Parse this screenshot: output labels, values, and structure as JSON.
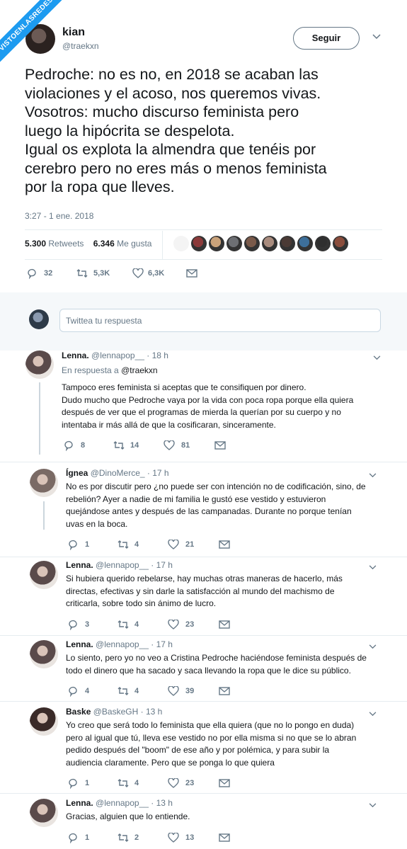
{
  "watermark": "VISTOENLASREDES.COM",
  "main_tweet": {
    "name": "kian",
    "handle": "@traekxn",
    "follow_label": "Seguir",
    "text_lines": [
      "Pedroche: no es no, en 2018 se acaban las",
      "violaciones y el acoso, nos queremos vivas.",
      "Vosotros: mucho discurso feminista pero",
      "luego la hipócrita se despelota.",
      "Igual os explota la almendra que tenéis por",
      "cerebro pero no eres más o menos feminista",
      "por la ropa que lleves."
    ],
    "timestamp": "3:27 - 1 ene. 2018",
    "retweets_count": "5.300",
    "retweets_label": "Retweets",
    "likes_count": "6.346",
    "likes_label": "Me gusta",
    "liker_colors": [
      "#d8d8d8",
      "#8b3a3a",
      "#c9a27a",
      "#6d6f73",
      "#7a5a4a",
      "#a98c7e",
      "#4a3a35",
      "#3d6f9a",
      "#2f2f2f",
      "#8a4d3c"
    ],
    "replies": "32",
    "retweets_short": "5,3K",
    "likes_short": "6,3K"
  },
  "reply_box": {
    "placeholder": "Twittea tu respuesta"
  },
  "replies": [
    {
      "name": "Lenna.",
      "handle": "@lennapop__",
      "time": "· 18 h",
      "in_reply_prefix": "En respuesta a",
      "in_reply_user": "@traekxn",
      "lines": [
        "Tampoco eres feminista si aceptas que te consifiquen por dinero.",
        "Dudo mucho que Pedroche vaya por la vida con poca ropa porque ella quiera",
        "después de ver que el programas de mierda la querían por su cuerpo y no",
        "intentaba ir más allá de que la cosificaran, sinceramente."
      ],
      "reply_count": "8",
      "retweet_count": "14",
      "like_count": "81",
      "avatar_color": "#5a4a4a"
    },
    {
      "name": "Ígnea",
      "handle": "@DinoMerce_",
      "time": "· 17 h",
      "lines": [
        "No es por discutir pero ¿no puede ser con intención no de codificación, sino, de",
        "rebelión? Ayer a nadie de mi familia le gustó ese vestido y estuvieron",
        "quejándose antes y después de las campanadas. Durante no porque tenían",
        "uvas en la boca."
      ],
      "reply_count": "1",
      "retweet_count": "4",
      "like_count": "21",
      "avatar_color": "#7a6a65"
    },
    {
      "name": "Lenna.",
      "handle": "@lennapop__",
      "time": "· 17 h",
      "lines": [
        "Si hubiera querido rebelarse, hay muchas otras maneras de hacerlo, más",
        "directas, efectivas y sin darle la satisfacción al mundo del machismo de",
        "criticarla, sobre todo sin ánimo de lucro."
      ],
      "reply_count": "3",
      "retweet_count": "4",
      "like_count": "23",
      "avatar_color": "#5a4a4a"
    },
    {
      "name": "Lenna.",
      "handle": "@lennapop__",
      "time": "· 17 h",
      "lines": [
        "Lo siento, pero yo no veo a Cristina Pedroche haciéndose feminista después de",
        "todo el dinero que ha sacado y saca llevando la ropa que le dice su público."
      ],
      "reply_count": "4",
      "retweet_count": "4",
      "like_count": "39",
      "avatar_color": "#5a4a4a"
    },
    {
      "name": "Baske",
      "handle": "@BaskeGH",
      "time": "· 13 h",
      "lines": [
        "Yo creo que será todo lo feminista que ella quiera (que no lo pongo en duda)",
        "pero al igual que tú, lleva ese vestido no por ella misma si no que se lo abran",
        "pedido después del \"boom\" de ese año y por polémica, y para subir la",
        "audiencia claramente. Pero que se ponga lo que quiera"
      ],
      "reply_count": "1",
      "retweet_count": "4",
      "like_count": "23",
      "avatar_color": "#3a2a28"
    },
    {
      "name": "Lenna.",
      "handle": "@lennapop__",
      "time": "· 13 h",
      "lines": [
        "Gracias, alguien que lo entiende."
      ],
      "reply_count": "1",
      "retweet_count": "2",
      "like_count": "13",
      "avatar_color": "#5a4a4a"
    }
  ]
}
